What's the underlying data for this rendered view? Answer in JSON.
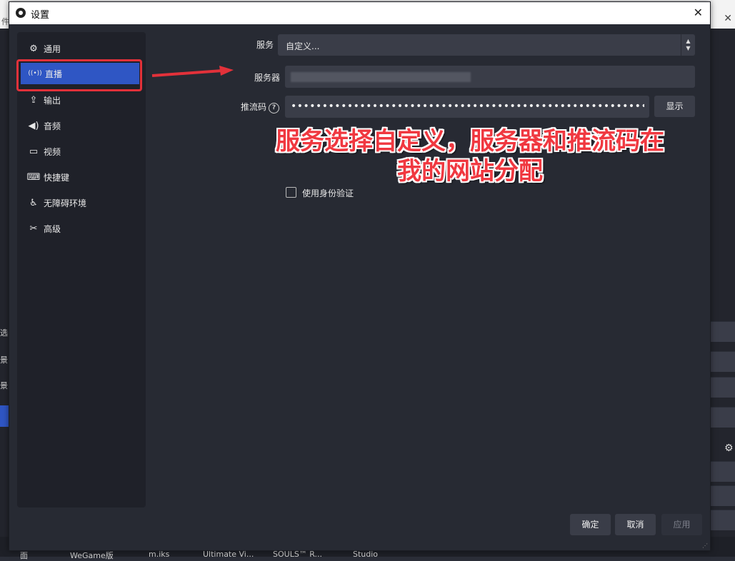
{
  "background": {
    "top_fragment": "件(",
    "left_fragments": [
      "选",
      "景",
      "景"
    ],
    "taskbar": [
      "WeGame版",
      "m.iks",
      "Ultimate Vi...",
      "SOULS™ R...",
      "Studio"
    ]
  },
  "dialog": {
    "title": "设置",
    "sidebar": {
      "items": [
        {
          "label": "通用",
          "icon": "gear-icon",
          "glyph": "⚙"
        },
        {
          "label": "直播",
          "icon": "broadcast-icon",
          "glyph": "((•))"
        },
        {
          "label": "输出",
          "icon": "output-icon",
          "glyph": "⇪"
        },
        {
          "label": "音频",
          "icon": "speaker-icon",
          "glyph": "🔊"
        },
        {
          "label": "视频",
          "icon": "monitor-icon",
          "glyph": "▭"
        },
        {
          "label": "快捷键",
          "icon": "keyboard-icon",
          "glyph": "⌨"
        },
        {
          "label": "无障碍环境",
          "icon": "accessibility-icon",
          "glyph": "♿"
        },
        {
          "label": "高级",
          "icon": "tools-icon",
          "glyph": "✂"
        }
      ],
      "active_index": 1
    },
    "form": {
      "service_label": "服务",
      "service_value": "自定义...",
      "server_label": "服务器",
      "stream_key_label": "推流码",
      "stream_key_value": "•••••••••••••••••••••••••••••••••••••••••••••••••••••••••••••••",
      "show_button": "显示",
      "auth_checkbox_label": "使用身份验证",
      "auth_checked": false
    },
    "buttons": {
      "ok": "确定",
      "cancel": "取消",
      "apply": "应用"
    }
  },
  "annotation": {
    "text_line1": "服务选择自定义，服务器和推流码在",
    "text_line2": "我的网站分配",
    "color": "#f03840"
  }
}
